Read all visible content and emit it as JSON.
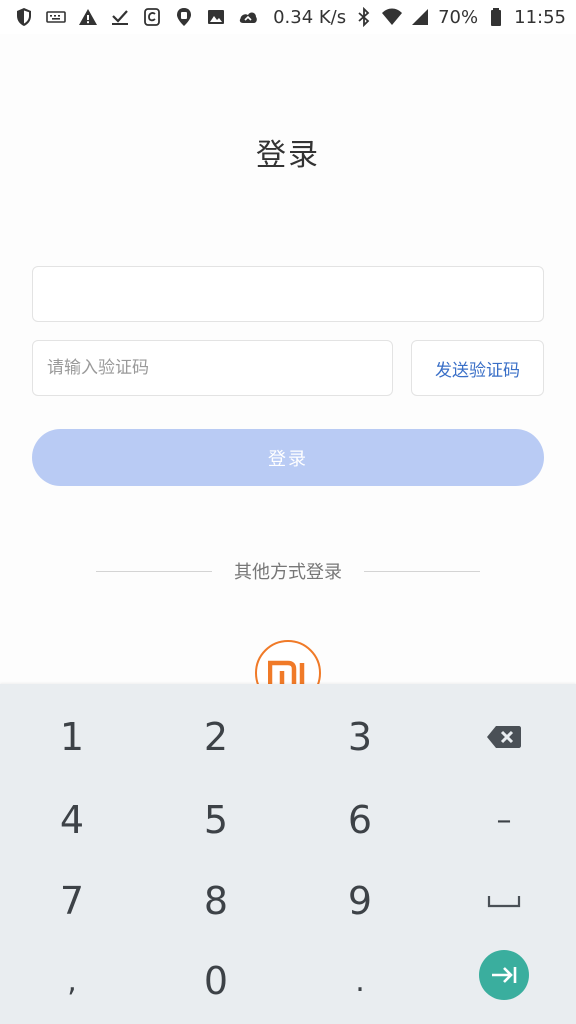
{
  "status_bar": {
    "net_speed": "0.34 K/s",
    "battery": "70%",
    "time": "11:55",
    "icons": [
      "shield-icon",
      "keyboard-icon",
      "warning-icon",
      "download-done-icon",
      "app-icon",
      "location-icon",
      "image-icon",
      "cloud-icon",
      "bluetooth-icon",
      "wifi-icon",
      "cellular-signal-icon",
      "battery-icon"
    ]
  },
  "login": {
    "title": "登录",
    "phone_value": "",
    "code_placeholder": "请输入验证码",
    "send_code_label": "发送验证码",
    "submit_label": "登录",
    "other_methods_label": "其他方式登录",
    "alt_provider_icon": "xiaomi-logo-icon"
  },
  "colors": {
    "accent_link": "#3a6fc7",
    "login_button_disabled": "#b9cbf4",
    "xiaomi_orange": "#f07a28",
    "enter_key": "#3aae9e",
    "keyboard_bg": "#e9edf0"
  },
  "keyboard": {
    "keys": [
      {
        "label": "1"
      },
      {
        "label": "2"
      },
      {
        "label": "3"
      },
      {
        "label": ""
      },
      {
        "label": "4"
      },
      {
        "label": "5"
      },
      {
        "label": "6"
      },
      {
        "label": "–"
      },
      {
        "label": "7"
      },
      {
        "label": "8"
      },
      {
        "label": "9"
      },
      {
        "label": ""
      },
      {
        "label": ","
      },
      {
        "label": "0"
      },
      {
        "label": "."
      },
      {
        "label": ""
      }
    ],
    "special_icons": [
      "backspace-icon",
      "space-icon",
      "enter-icon"
    ]
  }
}
